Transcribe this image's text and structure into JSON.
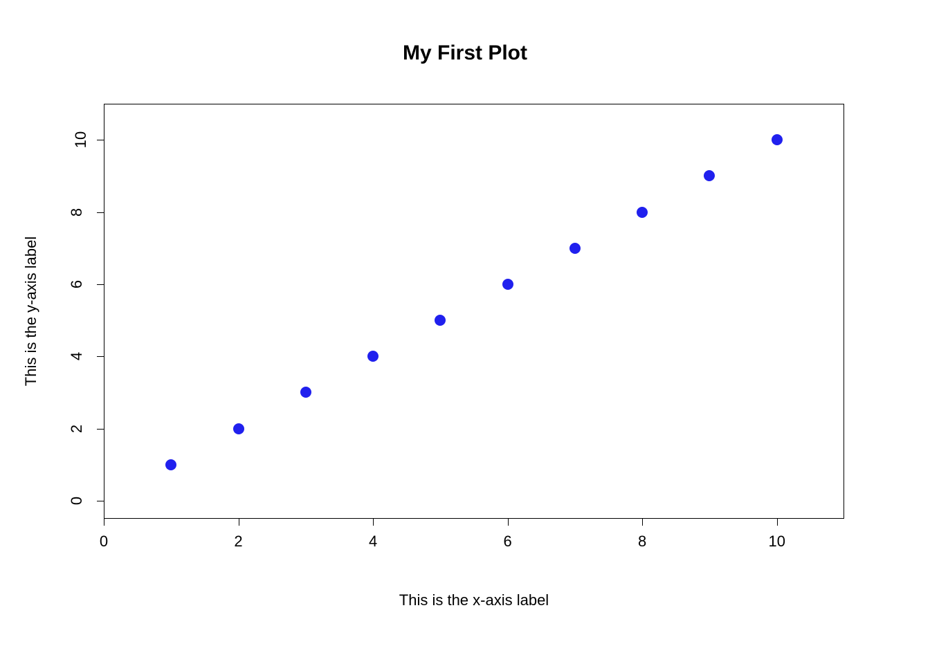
{
  "chart_data": {
    "type": "scatter",
    "title": "My First Plot",
    "xlabel": "This is the x-axis label",
    "ylabel": "This is the y-axis label",
    "x": [
      1,
      2,
      3,
      4,
      5,
      6,
      7,
      8,
      9,
      10
    ],
    "y": [
      1,
      2,
      3,
      4,
      5,
      6,
      7,
      8,
      9,
      10
    ],
    "xlim": [
      0,
      11
    ],
    "ylim": [
      -0.5,
      11
    ],
    "x_ticks": [
      0,
      2,
      4,
      6,
      8,
      10
    ],
    "y_ticks": [
      0,
      2,
      4,
      6,
      8,
      10
    ],
    "point_color": "#2020EE"
  }
}
